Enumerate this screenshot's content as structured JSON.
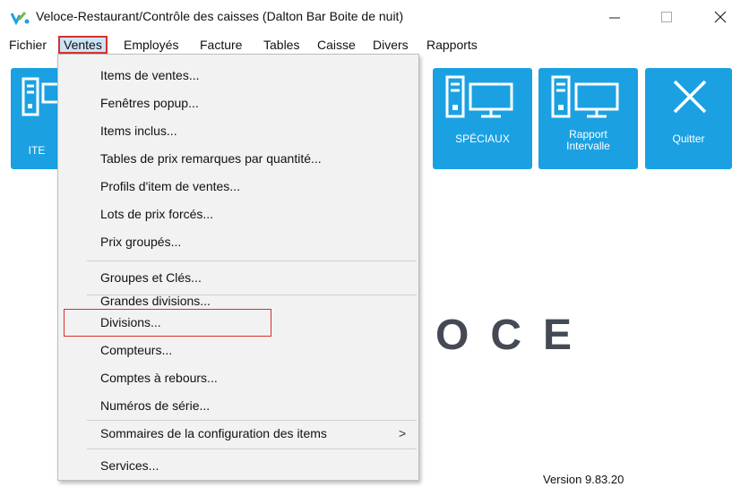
{
  "window": {
    "title": "Veloce-Restaurant/Contrôle des caisses (Dalton Bar Boite de nuit)",
    "minimize_glyph": "—",
    "maximize_glyph": "☐",
    "close_glyph": "✕"
  },
  "menubar": {
    "items": [
      {
        "label": "Fichier"
      },
      {
        "label": "Ventes"
      },
      {
        "label": "Employés"
      },
      {
        "label": "Facture"
      },
      {
        "label": "Tables"
      },
      {
        "label": "Caisse"
      },
      {
        "label": "Divers"
      },
      {
        "label": "Rapports"
      }
    ]
  },
  "tiles": [
    {
      "label": "ITE",
      "icon": "computer-icon"
    },
    {
      "label": "SPÉCIAUX",
      "icon": "computer-icon"
    },
    {
      "label_line1": "Rapport",
      "label_line2": "Intervalle",
      "icon": "computer-icon"
    },
    {
      "label": "Quitter",
      "icon": "close-icon"
    }
  ],
  "dropdown": {
    "items": [
      {
        "label": "Items de ventes..."
      },
      {
        "label": "Fenêtres popup..."
      },
      {
        "label": "Items inclus..."
      },
      {
        "label": "Tables de prix remarques par quantité..."
      },
      {
        "label": "Profils d'item de ventes..."
      },
      {
        "label": "Lots de prix forcés..."
      },
      {
        "label": "Prix groupés..."
      },
      {
        "label": "Groupes et Clés..."
      },
      {
        "label": "Grandes divisions..."
      },
      {
        "label": "Divisions..."
      },
      {
        "label": "Compteurs..."
      },
      {
        "label": "Comptes à rebours..."
      },
      {
        "label": "Numéros de série..."
      },
      {
        "label": "Sommaires de la configuration des items",
        "submenu_arrow": ">"
      },
      {
        "label": "Services..."
      }
    ]
  },
  "logo_text": "OCE",
  "version": "Version 9.83.20",
  "colors": {
    "tile": "#1ba1e2",
    "highlight": "#d9302b",
    "menu_active_bg": "#cce4f7",
    "logo": "#434a54"
  }
}
